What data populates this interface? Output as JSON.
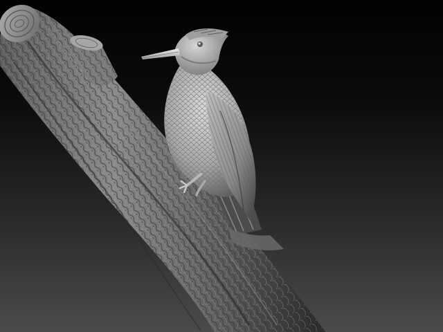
{
  "scene": {
    "subject": "sculpted-woodpecker-on-branch",
    "colors": {
      "background_top": "#020202",
      "background_bottom": "#4b4b4b",
      "bark_light": "#8e8e8e",
      "bark_dark": "#2e2e2e",
      "feather_light": "#d8d8d8",
      "feather_dark": "#5a5a5a",
      "beak": "#e6e6e6"
    }
  }
}
